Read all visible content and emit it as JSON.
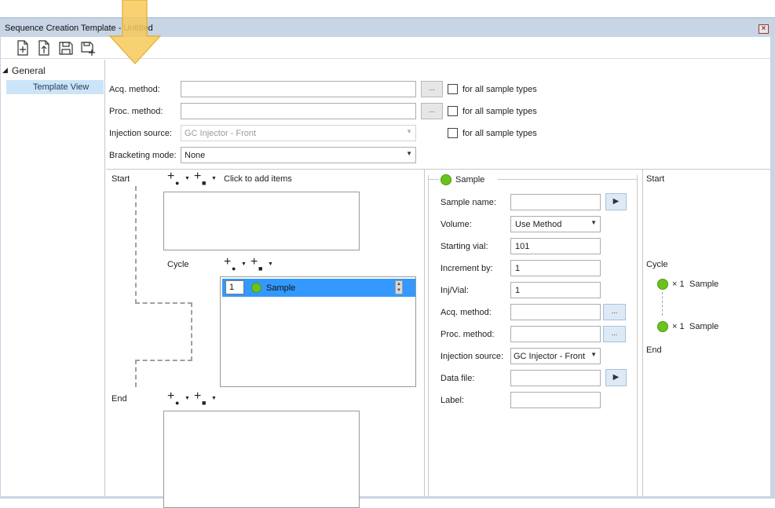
{
  "window": {
    "title": "Sequence Creation Template - Untitled"
  },
  "toolbar": {
    "icons": [
      "new-document-icon",
      "upload-document-icon",
      "save-icon",
      "save-as-icon"
    ]
  },
  "nav": {
    "group": "General",
    "item": "Template View"
  },
  "form": {
    "acq_label": "Acq. method:",
    "acq_value": "",
    "proc_label": "Proc. method:",
    "proc_value": "",
    "inj_label": "Injection source:",
    "inj_value": "GC Injector - Front",
    "brack_label": "Bracketing mode:",
    "brack_value": "None",
    "ellipsis": "...",
    "all_types": "for all sample types"
  },
  "structure": {
    "start": "Start",
    "cycle": "Cycle",
    "end": "End",
    "add_hint": "Click to add items",
    "cycle_row": {
      "index": "1",
      "name": "Sample"
    }
  },
  "props": {
    "header": "Sample",
    "sample_name_label": "Sample name:",
    "sample_name": "",
    "volume_label": "Volume:",
    "volume": "Use Method",
    "starting_vial_label": "Starting vial:",
    "starting_vial": "101",
    "increment_label": "Increment by:",
    "increment": "1",
    "inj_vial_label": "Inj/Vial:",
    "inj_vial": "1",
    "acq_label": "Acq. method:",
    "acq": "",
    "proc_label": "Proc. method:",
    "proc": "",
    "inj_source_label": "Injection source:",
    "inj_source": "GC Injector - Front",
    "data_file_label": "Data file:",
    "data_file": "",
    "label_label": "Label:",
    "label": "",
    "ellipsis": "..."
  },
  "preview": {
    "start": "Start",
    "cycle": "Cycle",
    "end": "End",
    "item1_mult": "× 1",
    "item1_name": "Sample",
    "item2_mult": "× 1",
    "item2_name": "Sample"
  },
  "colors": {
    "accent": "#3399ff",
    "sample_green": "#6cc21d",
    "chrome": "#c7d5e4",
    "annotation_arrow": "#f7c95a"
  }
}
